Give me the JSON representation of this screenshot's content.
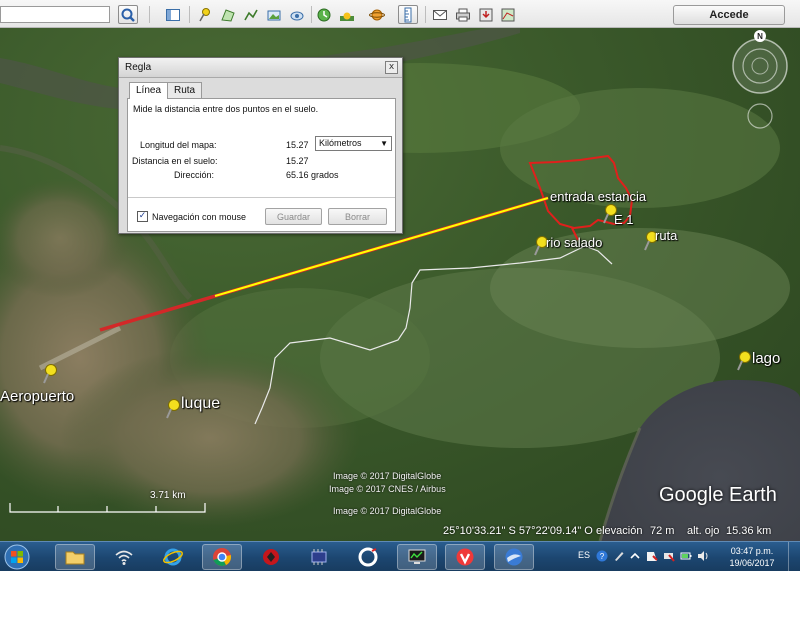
{
  "toolbar": {
    "sign_in_label": "Accede"
  },
  "dialog": {
    "title": "Regla",
    "close_glyph": "x",
    "tabs": [
      "Línea",
      "Ruta"
    ],
    "instruction": "Mide la distancia entre dos puntos en el suelo.",
    "map_length_label": "Longitud del mapa:",
    "map_length_value": "15.27",
    "unit": "Kilómetros",
    "ground_distance_label": "Distancia en el suelo:",
    "ground_distance_value": "15.27",
    "direction_label": "Dirección:",
    "direction_value": "65.16 grados",
    "mouse_nav_label": "Navegación con mouse",
    "mouse_nav_checked": true,
    "check_glyph": "✓",
    "save_label": "Guardar",
    "clear_label": "Borrar"
  },
  "map": {
    "placemarks": [
      "entrada estancia",
      "E 1",
      "rio salado",
      "ruta",
      "lago",
      "Aeropuerto",
      "luque"
    ],
    "credits": [
      "Image © 2017 DigitalGlobe",
      "Image © 2017 CNES / Airbus",
      "Image © 2017 DigitalGlobe"
    ],
    "logo": "Google Earth",
    "scale_label": "3.71 km",
    "compass_label": "N",
    "ruler_color": "#ffff00",
    "route_color": "#e02020"
  },
  "status": {
    "coordinates": "25°10'33.21\" S   57°22'09.14\" O",
    "elevation_label": "elevación",
    "elevation_value": "72 m",
    "eye_alt_label": "alt. ojo",
    "eye_alt_value": "15.36 km"
  },
  "taskbar": {
    "language": "ES",
    "time": "03:47 p.m.",
    "date": "19/06/2017"
  }
}
